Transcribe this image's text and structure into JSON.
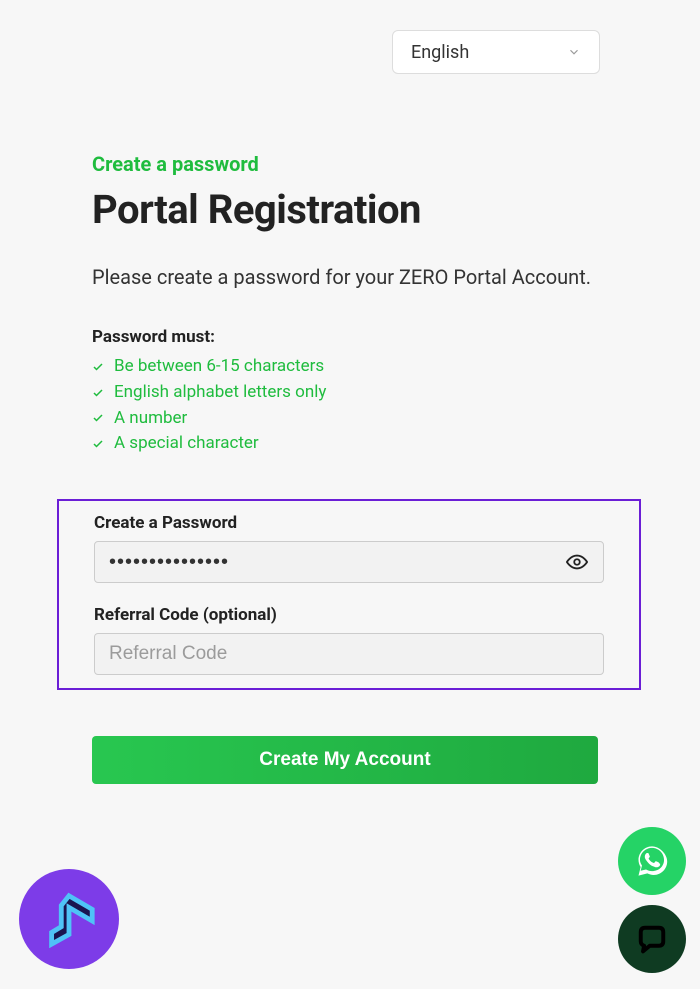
{
  "language": {
    "selected": "English"
  },
  "subtitle": "Create a password",
  "title": "Portal Registration",
  "description": "Please create a password for your ZERO Portal Account.",
  "requirements": {
    "heading": "Password must:",
    "items": [
      "Be between 6-15 characters",
      "English alphabet letters only",
      "A number",
      "A special character"
    ]
  },
  "form": {
    "password_label": "Create a Password",
    "password_value": "•••••••••••••••",
    "referral_label": "Referral Code (optional)",
    "referral_placeholder": "Referral Code",
    "referral_value": ""
  },
  "submit_label": "Create My Account"
}
